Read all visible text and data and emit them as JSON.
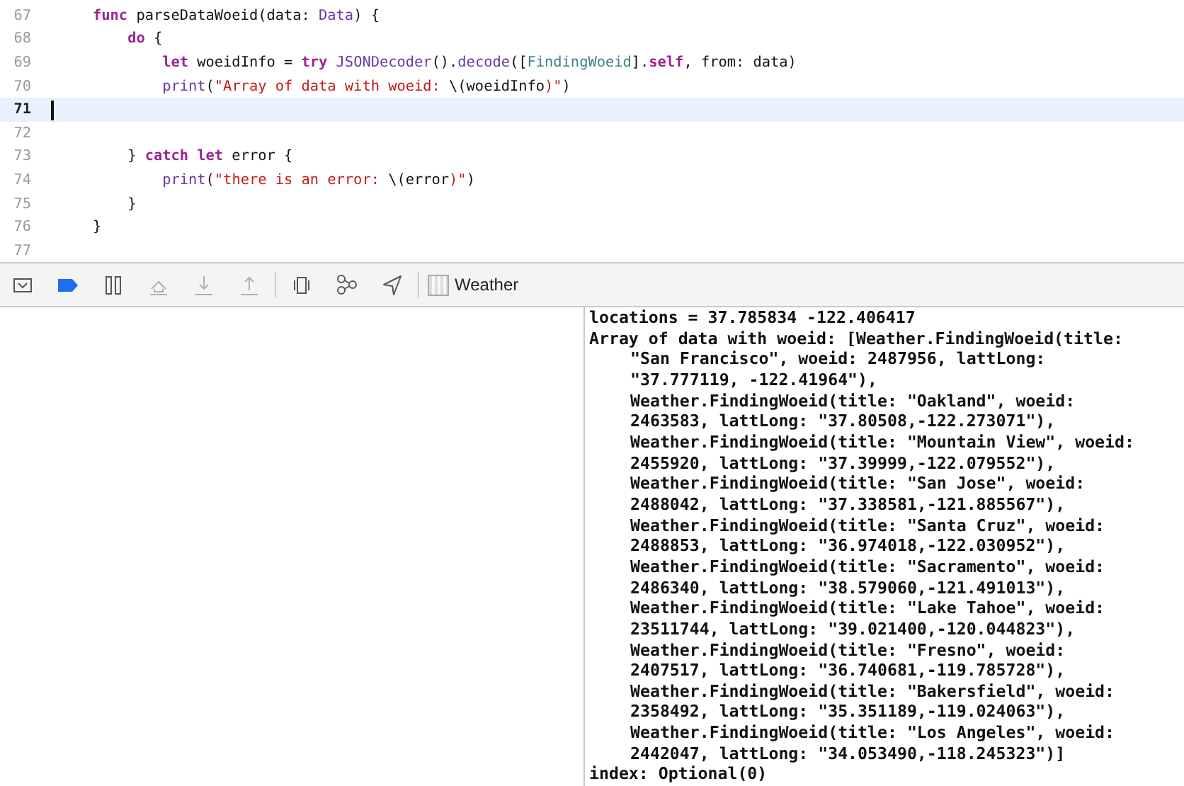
{
  "editor": {
    "lines": [
      {
        "number": "67",
        "current": false,
        "tokens": [
          {
            "kind": "keyword",
            "text": "    func"
          },
          {
            "kind": "plain",
            "text": " parseDataWoeid(data: "
          },
          {
            "kind": "type",
            "text": "Data"
          },
          {
            "kind": "plain",
            "text": ") {"
          }
        ]
      },
      {
        "number": "68",
        "current": false,
        "tokens": [
          {
            "kind": "keyword",
            "text": "        do"
          },
          {
            "kind": "plain",
            "text": " {"
          }
        ]
      },
      {
        "number": "69",
        "current": false,
        "tokens": [
          {
            "kind": "keyword",
            "text": "            let"
          },
          {
            "kind": "plain",
            "text": " woeidInfo = "
          },
          {
            "kind": "keyword",
            "text": "try "
          },
          {
            "kind": "type",
            "text": "JSONDecoder"
          },
          {
            "kind": "plain",
            "text": "()."
          },
          {
            "kind": "type",
            "text": "decode"
          },
          {
            "kind": "plain",
            "text": "(["
          },
          {
            "kind": "project",
            "text": "FindingWoeid"
          },
          {
            "kind": "plain",
            "text": "]."
          },
          {
            "kind": "keyword",
            "text": "self"
          },
          {
            "kind": "plain",
            "text": ", from: data)"
          }
        ]
      },
      {
        "number": "70",
        "current": false,
        "tokens": [
          {
            "kind": "type",
            "text": "            print"
          },
          {
            "kind": "plain",
            "text": "("
          },
          {
            "kind": "string",
            "text": "\"Array of data with woeid: "
          },
          {
            "kind": "plain",
            "text": "\\(woeidInfo"
          },
          {
            "kind": "string",
            "text": ")\""
          },
          {
            "kind": "plain",
            "text": ")"
          }
        ]
      },
      {
        "number": "71",
        "current": true
      },
      {
        "number": "72",
        "current": false
      },
      {
        "number": "73",
        "current": false,
        "tokens": [
          {
            "kind": "plain",
            "text": "        } "
          },
          {
            "kind": "keyword",
            "text": "catch let"
          },
          {
            "kind": "plain",
            "text": " error {"
          }
        ]
      },
      {
        "number": "74",
        "current": false,
        "tokens": [
          {
            "kind": "type",
            "text": "            print"
          },
          {
            "kind": "plain",
            "text": "("
          },
          {
            "kind": "string",
            "text": "\"there is an error: "
          },
          {
            "kind": "plain",
            "text": "\\(error"
          },
          {
            "kind": "string",
            "text": ")\""
          },
          {
            "kind": "plain",
            "text": ")"
          }
        ]
      },
      {
        "number": "75",
        "current": false,
        "tokens": [
          {
            "kind": "plain",
            "text": "        }"
          }
        ]
      },
      {
        "number": "76",
        "current": false,
        "tokens": [
          {
            "kind": "plain",
            "text": "    }"
          }
        ]
      },
      {
        "number": "77",
        "current": false
      }
    ]
  },
  "debug_bar": {
    "buttons": [
      {
        "kind": "toggle-panel",
        "active": false,
        "disabled": false
      },
      {
        "kind": "breakpoints",
        "active": true,
        "disabled": false
      },
      {
        "kind": "pause",
        "active": false,
        "disabled": false
      },
      {
        "kind": "step-over",
        "active": false,
        "disabled": true
      },
      {
        "kind": "step-into",
        "active": false,
        "disabled": true
      },
      {
        "kind": "step-out",
        "active": false,
        "disabled": true
      },
      {
        "kind": "view-hierarchy",
        "active": false,
        "disabled": false
      },
      {
        "kind": "memory-graph",
        "active": false,
        "disabled": false
      },
      {
        "kind": "location",
        "active": false,
        "disabled": false
      }
    ],
    "scheme": "Weather"
  },
  "console": {
    "lines": [
      {
        "kind": "start",
        "text": "locations = 37.785834 -122.406417"
      },
      {
        "kind": "start",
        "text": "Array of data with woeid: [Weather.FindingWoeid(title:"
      },
      {
        "kind": "wrap",
        "text": "\"San Francisco\", woeid: 2487956, lattLong:"
      },
      {
        "kind": "wrap",
        "text": "\"37.777119, -122.41964\"),"
      },
      {
        "kind": "wrap",
        "text": "Weather.FindingWoeid(title: \"Oakland\", woeid:"
      },
      {
        "kind": "wrap",
        "text": "2463583, lattLong: \"37.80508,-122.273071\"),"
      },
      {
        "kind": "wrap",
        "text": "Weather.FindingWoeid(title: \"Mountain View\", woeid:"
      },
      {
        "kind": "wrap",
        "text": "2455920, lattLong: \"37.39999,-122.079552\"),"
      },
      {
        "kind": "wrap",
        "text": "Weather.FindingWoeid(title: \"San Jose\", woeid:"
      },
      {
        "kind": "wrap",
        "text": "2488042, lattLong: \"37.338581,-121.885567\"),"
      },
      {
        "kind": "wrap",
        "text": "Weather.FindingWoeid(title: \"Santa Cruz\", woeid:"
      },
      {
        "kind": "wrap",
        "text": "2488853, lattLong: \"36.974018,-122.030952\"),"
      },
      {
        "kind": "wrap",
        "text": "Weather.FindingWoeid(title: \"Sacramento\", woeid:"
      },
      {
        "kind": "wrap",
        "text": "2486340, lattLong: \"38.579060,-121.491013\"),"
      },
      {
        "kind": "wrap",
        "text": "Weather.FindingWoeid(title: \"Lake Tahoe\", woeid:"
      },
      {
        "kind": "wrap",
        "text": "23511744, lattLong: \"39.021400,-120.044823\"),"
      },
      {
        "kind": "wrap",
        "text": "Weather.FindingWoeid(title: \"Fresno\", woeid:"
      },
      {
        "kind": "wrap",
        "text": "2407517, lattLong: \"36.740681,-119.785728\"),"
      },
      {
        "kind": "wrap",
        "text": "Weather.FindingWoeid(title: \"Bakersfield\", woeid:"
      },
      {
        "kind": "wrap",
        "text": "2358492, lattLong: \"35.351189,-119.024063\"),"
      },
      {
        "kind": "wrap",
        "text": "Weather.FindingWoeid(title: \"Los Angeles\", woeid:"
      },
      {
        "kind": "wrap",
        "text": "2442047, lattLong: \"34.053490,-118.245323\")]"
      },
      {
        "kind": "start",
        "text": "index: Optional(0)"
      }
    ]
  }
}
